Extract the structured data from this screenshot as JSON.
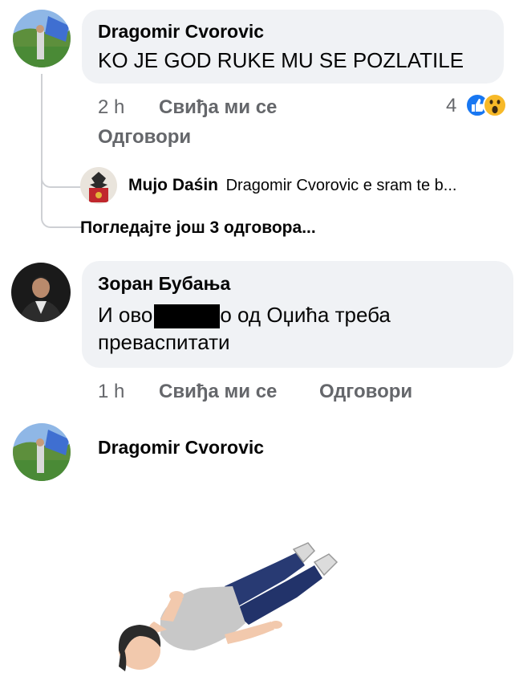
{
  "comments": [
    {
      "author": "Dragomir Cvorovic",
      "text": "KO JE GOD RUKE MU SE POZLATILE",
      "time": "2 h",
      "like_label": "Свиђа ми се",
      "reply_label": "Одговори",
      "reaction_count": "4",
      "reactions": [
        "like-icon",
        "wow-icon"
      ]
    },
    {
      "author": "Зоран Бубања",
      "text_before": "И ово",
      "text_after": "о од Оџића треба",
      "text_line2": "преваспитати",
      "time": "1 h",
      "like_label": "Свиђа ми се",
      "reply_label": "Одговори"
    },
    {
      "author": "Dragomir Cvorovic"
    }
  ],
  "reply_preview": {
    "author": "Mujo Daśin",
    "snippet": "Dragomir Cvorovic e sram te b..."
  },
  "view_more_replies": "Погледајте још 3 одговора...",
  "colors": {
    "bubble": "#f0f2f5",
    "meta": "#65676b",
    "like_blue": "#1877f2",
    "wow_yellow": "#f7b928"
  }
}
